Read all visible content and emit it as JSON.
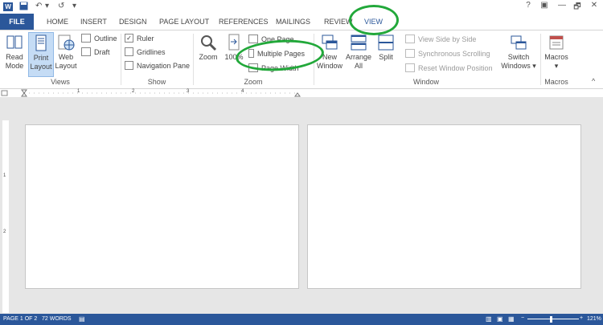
{
  "qat": {
    "word_icon": "W",
    "save_icon": "save-icon",
    "undo": "↶",
    "redo": "↺",
    "customize": "▾"
  },
  "window": {
    "help": "?",
    "ribbon_options": "▣",
    "minimize": "—",
    "restore": "🗗",
    "close": "✕"
  },
  "tabs": [
    {
      "label": "FILE"
    },
    {
      "label": "HOME"
    },
    {
      "label": "INSERT"
    },
    {
      "label": "DESIGN"
    },
    {
      "label": "PAGE LAYOUT"
    },
    {
      "label": "REFERENCES"
    },
    {
      "label": "MAILINGS"
    },
    {
      "label": "REVIEW"
    },
    {
      "label": "VIEW"
    }
  ],
  "ribbon": {
    "views": {
      "label": "Views",
      "read_mode": "Read Mode",
      "print_layout": "Print Layout",
      "web_layout": "Web Layout",
      "outline": "Outline",
      "draft": "Draft"
    },
    "show": {
      "label": "Show",
      "ruler": "Ruler",
      "gridlines": "Gridlines",
      "navigation": "Navigation Pane",
      "ruler_checked": "✓"
    },
    "zoom": {
      "label": "Zoom",
      "zoom": "Zoom",
      "hundred": "100%",
      "one_page": "One Page",
      "multiple_pages": "Multiple Pages",
      "page_width": "Page Width"
    },
    "window": {
      "label": "Window",
      "new_window": "New Window",
      "arrange_all": "Arrange All",
      "split": "Split",
      "side_by_side": "View Side by Side",
      "sync_scroll": "Synchronous Scrolling",
      "reset_position": "Reset Window Position",
      "switch_windows": "Switch Windows ▾"
    },
    "macros": {
      "label": "Macros",
      "macros": "Macros ▾"
    },
    "collapse": "^"
  },
  "ruler": {
    "marks": [
      "1",
      "2",
      "3",
      "4"
    ]
  },
  "vruler": {
    "marks": [
      "1",
      "2"
    ]
  },
  "status": {
    "page": "PAGE 1 OF 2",
    "words": "72 WORDS",
    "zoom": "121%",
    "zoom_minus": "−",
    "zoom_plus": "+"
  },
  "colors": {
    "accent": "#2b579a",
    "highlight": "#22a83a"
  }
}
